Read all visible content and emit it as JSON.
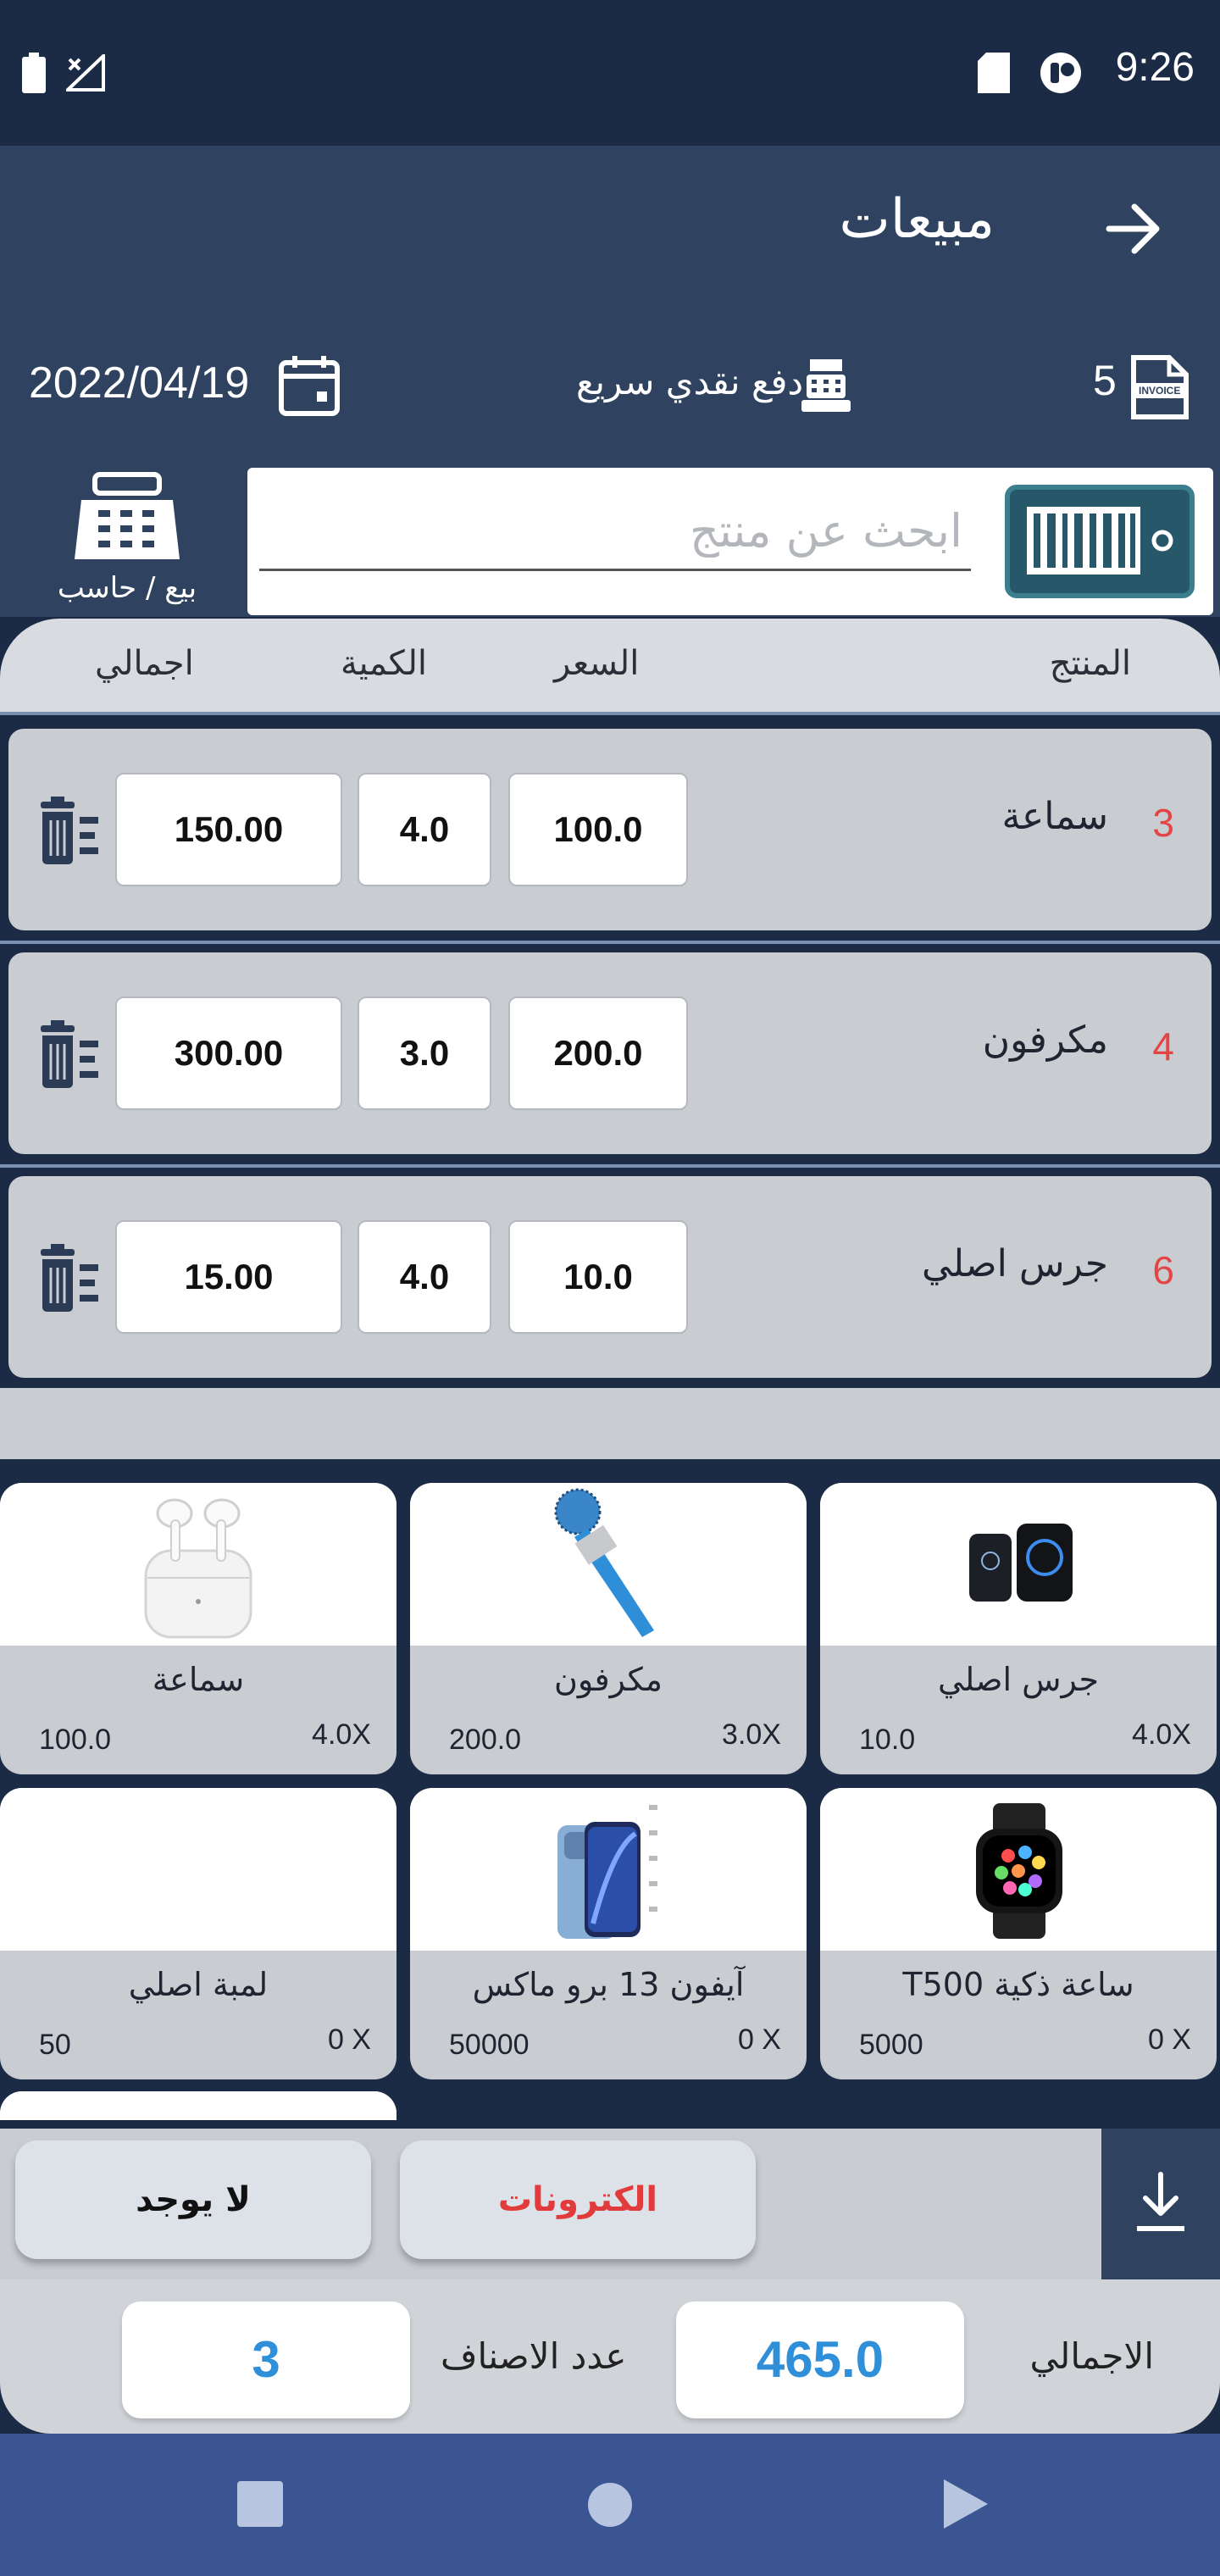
{
  "status_bar": {
    "time": "9:26"
  },
  "app_bar": {
    "title": "مبيعات"
  },
  "invoice_info": {
    "date": "2022/04/19",
    "payment_mode": "دفع نقدي سريع",
    "invoice_number": "5",
    "invoice_icon_text": "INVOICE"
  },
  "search": {
    "placeholder": "ابحث عن منتج",
    "value": ""
  },
  "sell_calc": {
    "label": "بيع / حاسب"
  },
  "table_header": {
    "product": "المنتج",
    "price": "السعر",
    "quantity": "الكمية",
    "total": "اجمالي"
  },
  "items": [
    {
      "number": "3",
      "name": "سماعة",
      "price": "100.0",
      "quantity": "4.0",
      "total": "150.00"
    },
    {
      "number": "4",
      "name": "مكرفون",
      "price": "200.0",
      "quantity": "3.0",
      "total": "300.00"
    },
    {
      "number": "6",
      "name": "جرس اصلي",
      "price": "10.0",
      "quantity": "4.0",
      "total": "15.00"
    }
  ],
  "products": [
    {
      "name": "جرس اصلي",
      "price": "10.0",
      "qty": "4.0X",
      "image": "doorbell"
    },
    {
      "name": "مكرفون",
      "price": "200.0",
      "qty": "3.0X",
      "image": "microphone"
    },
    {
      "name": "سماعة",
      "price": "100.0",
      "qty": "4.0X",
      "image": "airpods"
    },
    {
      "name": "ساعة ذكية T500",
      "price": "5000",
      "qty": "0 X",
      "image": "smartwatch"
    },
    {
      "name": "آيفون 13 برو ماكس",
      "price": "50000",
      "qty": "0 X",
      "image": "iphone"
    },
    {
      "name": "لمبة اصلي",
      "price": "50",
      "qty": "0 X",
      "image": "none"
    }
  ],
  "payment": {
    "none_label": "لا يوجد",
    "electronic_label": "الكترونات"
  },
  "totals": {
    "total_label": "الاجمالي",
    "total_value": "465.0",
    "items_label": "عدد الاصناف",
    "items_value": "3"
  },
  "colors": {
    "dark_navy": "#1b2a45",
    "header_blue": "#2f4360",
    "accent_blue": "#2f8fd8",
    "red": "#e34545",
    "nav_blue": "#3a5592"
  }
}
